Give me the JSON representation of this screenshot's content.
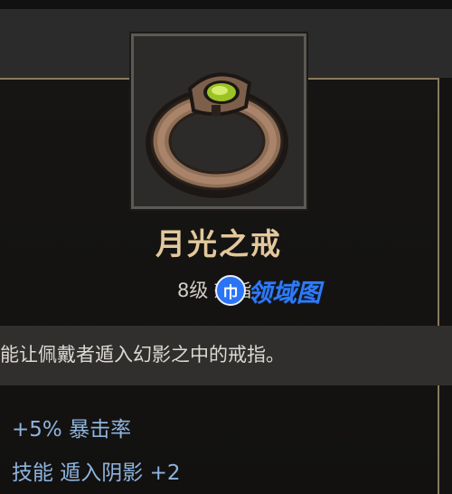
{
  "item": {
    "name": "月光之戒",
    "level": "8级",
    "slot": "戒指",
    "description": "能让佩戴者遁入幻影之中的戒指。",
    "icon": "ring-icon",
    "stats": [
      "+5% 暴击率",
      "技能 遁入阴影 +2"
    ]
  },
  "watermark": {
    "badge": "巾",
    "text": "领域图"
  },
  "colors": {
    "name": "#e3c89c",
    "stat": "#8eb4de",
    "border": "#8a7a5d",
    "gem": "#b6d63a"
  }
}
